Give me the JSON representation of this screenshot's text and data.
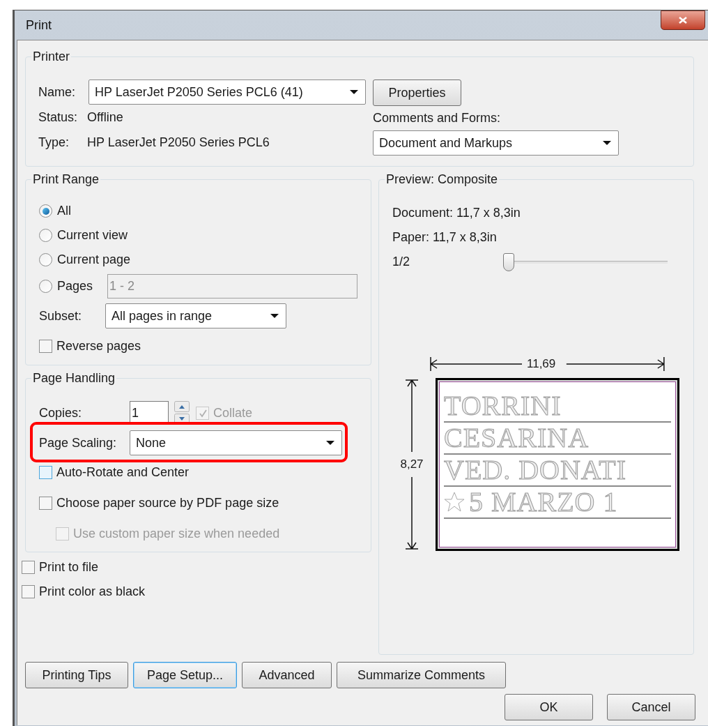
{
  "window": {
    "title": "Print"
  },
  "printer": {
    "title": "Printer",
    "name_label": "Name:",
    "name_value": "HP LaserJet P2050 Series PCL6 (41)",
    "properties_button": "Properties",
    "status_label": "Status:",
    "status_value": "Offline",
    "type_label": "Type:",
    "type_value": "HP LaserJet P2050 Series PCL6",
    "comments_label": "Comments and Forms:",
    "comments_value": "Document and Markups"
  },
  "print_range": {
    "title": "Print Range",
    "options": [
      {
        "label": "All",
        "selected": true
      },
      {
        "label": "Current view",
        "selected": false
      },
      {
        "label": "Current page",
        "selected": false
      },
      {
        "label": "Pages",
        "selected": false
      }
    ],
    "pages_value": "1 - 2",
    "subset_label": "Subset:",
    "subset_value": "All pages in range",
    "reverse": {
      "label": "Reverse pages",
      "checked": false
    }
  },
  "page_handling": {
    "title": "Page Handling",
    "copies_label": "Copies:",
    "copies_value": "1",
    "collate": {
      "label": "Collate",
      "checked": true,
      "disabled": true
    },
    "scaling_label": "Page Scaling:",
    "scaling_value": "None",
    "scaling_highlighted": true,
    "checkboxes": [
      {
        "label": "Auto-Rotate and Center",
        "checked": false,
        "hovered": true,
        "disabled": false,
        "indented": false
      },
      {
        "label": "Choose paper source by PDF page size",
        "checked": false,
        "hovered": false,
        "disabled": false,
        "indented": false
      },
      {
        "label": "Use custom paper size when needed",
        "checked": false,
        "hovered": false,
        "disabled": true,
        "indented": true
      }
    ]
  },
  "options": [
    {
      "label": "Print to file",
      "checked": false
    },
    {
      "label": "Print color as black",
      "checked": false
    }
  ],
  "preview": {
    "title": "Preview: Composite",
    "document": "Document: 11,7 x 8,3in",
    "paper": "Paper: 11,7 x 8,3in",
    "page": "1/2",
    "level": 0.03,
    "width_label": "11,69",
    "height_label": "8,27",
    "lines": [
      "TORRINI",
      "CESARINA",
      "VED. DONATI",
      "5 MARZO 1"
    ]
  },
  "buttons": [
    {
      "label": "Printing Tips",
      "focused": false
    },
    {
      "label": "Page Setup...",
      "focused": true
    },
    {
      "label": "Advanced",
      "focused": false
    },
    {
      "label": "Summarize Comments",
      "focused": false
    }
  ],
  "dialog_buttons": [
    "OK",
    "Cancel"
  ]
}
